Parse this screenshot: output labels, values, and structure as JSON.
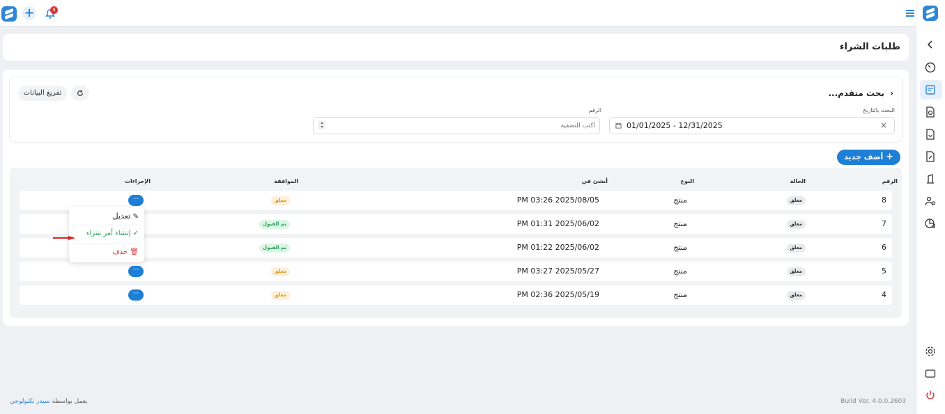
{
  "app": {
    "notifications_count": "4"
  },
  "page": {
    "title": "طلبات الشراء"
  },
  "search": {
    "advanced_title": "بحث متقدم...",
    "date_label": "البحث بالتاريخ",
    "date_value": "01/01/2025 - 12/31/2025",
    "number_label": "الرقم",
    "number_placeholder": "أكتب للتصفية",
    "clear_label": "تفريغ البيانات"
  },
  "actions": {
    "add_new": "أضف جديد"
  },
  "table": {
    "headers": {
      "number": "الرقم",
      "status": "الحالة",
      "type": "النوع",
      "created_at": "أنشئ في",
      "approval": "الموافقة",
      "actions": "الإجراءات"
    },
    "rows": [
      {
        "number": "8",
        "status": "معلق",
        "type": "منتج",
        "created_at": "PM 03:26 2025/08/05",
        "approval": "معلق"
      },
      {
        "number": "7",
        "status": "معلق",
        "type": "منتج",
        "created_at": "PM 01:31 2025/06/02",
        "approval": "تم القبول"
      },
      {
        "number": "6",
        "status": "معلق",
        "type": "منتج",
        "created_at": "PM 01:22 2025/06/02",
        "approval": "تم القبول"
      },
      {
        "number": "5",
        "status": "معلق",
        "type": "منتج",
        "created_at": "PM 03:27 2025/05/27",
        "approval": "معلق"
      },
      {
        "number": "4",
        "status": "معلق",
        "type": "منتج",
        "created_at": "PM 02:36 2025/05/19",
        "approval": "معلق"
      }
    ],
    "row_menu_label": "···"
  },
  "row_menu": {
    "edit": "تعديل",
    "create_po": "إنشاء أمر شراء",
    "delete": "حذف"
  },
  "footer": {
    "powered_prefix": "يعمل بواسطة",
    "powered_company": "سيدر تكنولوجي",
    "build": "Build Ver. 4.0.0.2603"
  },
  "colors": {
    "primary": "#1e7fd6",
    "pending_bg": "#fdf0d8",
    "pending_text": "#d99a22",
    "accepted_bg": "#def5e6",
    "accepted_text": "#23a25a",
    "delete_text": "#d6383e"
  }
}
